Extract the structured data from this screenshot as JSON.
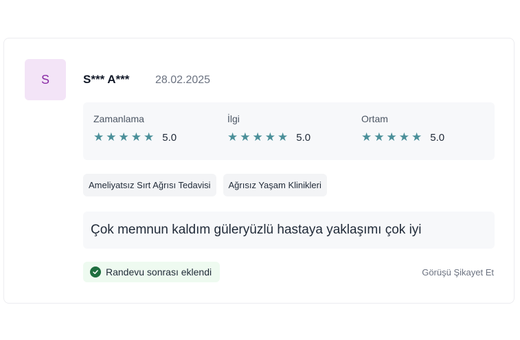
{
  "review": {
    "avatar_initial": "S",
    "author": "S*** A***",
    "date": "28.02.2025",
    "ratings": [
      {
        "label": "Zamanlama",
        "score": "5.0",
        "stars": 5
      },
      {
        "label": "İlgi",
        "score": "5.0",
        "stars": 5
      },
      {
        "label": "Ortam",
        "score": "5.0",
        "stars": 5
      }
    ],
    "tags": [
      "Ameliyatsız Sırt Ağrısı Tedavisi",
      "Ağrısız Yaşam Klinikleri"
    ],
    "comment": "Çok memnun kaldım güleryüzlü hastaya yaklaşımı çok iyi",
    "badge": "Randevu sonrası eklendi",
    "report_link": "Görüşü Şikayet Et"
  },
  "colors": {
    "star": "#4a8f99",
    "avatar_bg": "#f3e4f7",
    "avatar_text": "#8a2ca6",
    "badge_bg": "#eefaf0",
    "check": "#1f6e3f"
  }
}
